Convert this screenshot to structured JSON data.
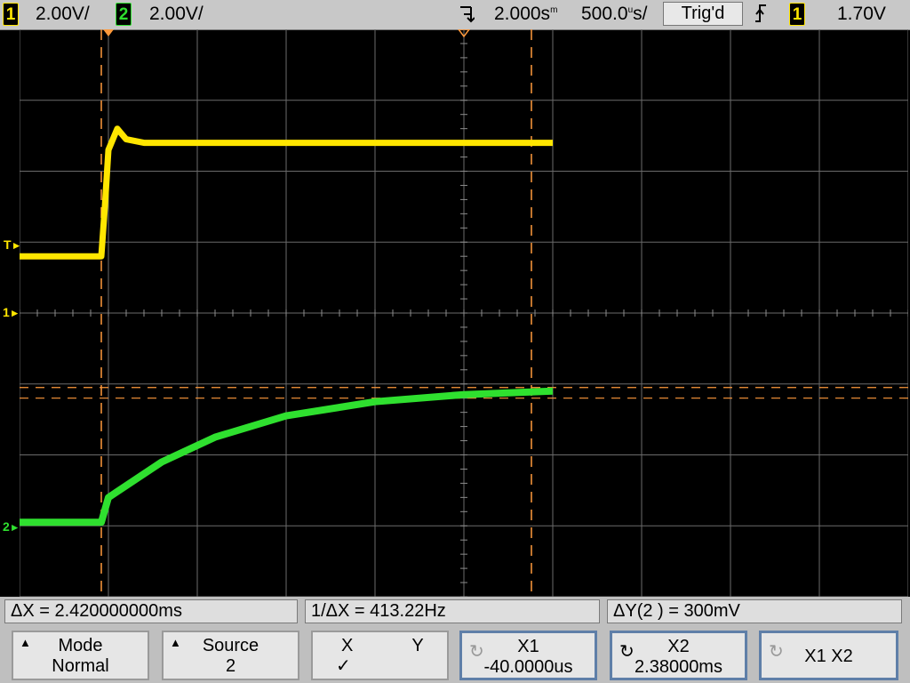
{
  "topbar": {
    "ch1_number": "1",
    "ch1_scale": "2.00V/",
    "ch2_number": "2",
    "ch2_scale": "2.00V/",
    "delay": "2.000s",
    "delay_unit_prefix": "m",
    "timebase": "500.0",
    "timebase_unit_prefix": "u",
    "timebase_suffix": "s/",
    "trigger_state": "Trig'd",
    "trigger_slope_icon": "rising-edge-icon",
    "trigger_source": "1",
    "trigger_level": "1.70V"
  },
  "markers": {
    "trigger_marker": "T",
    "ch1_ground": "1",
    "ch2_ground": "2"
  },
  "readouts": {
    "delta_x": "ΔX = 2.420000000ms",
    "inv_delta_x": "1/ΔX = 413.22Hz",
    "delta_y": "ΔY(2 ) = 300mV"
  },
  "softkeys": {
    "mode_label": "Mode",
    "mode_value": "Normal",
    "source_label": "Source",
    "source_value": "2",
    "xy_x": "X",
    "xy_y": "Y",
    "xy_check": "✓",
    "x1_label": "X1",
    "x1_value": "-40.0000us",
    "x2_label": "X2",
    "x2_value": "2.38000ms",
    "x1x2_label": "X1 X2"
  },
  "colors": {
    "ch1": "#ffe600",
    "ch2": "#2fe02f",
    "cursor": "#ff9a3c",
    "grid": "#6b6b6b"
  },
  "chart_data": {
    "type": "line",
    "series": [
      {
        "name": "1",
        "color": "#ffe600",
        "x_ms": [
          -2.5,
          -0.04,
          -0.02,
          0.0,
          0.05,
          0.1,
          0.2,
          2.5
        ],
        "y_div": [
          0.8,
          0.8,
          1.5,
          2.3,
          2.6,
          2.45,
          2.4,
          2.4
        ]
      },
      {
        "name": "2",
        "color": "#2fe02f",
        "x_ms": [
          -2.5,
          -0.04,
          0.0,
          0.3,
          0.6,
          1.0,
          1.5,
          2.0,
          2.5
        ],
        "y_div": [
          -2.95,
          -2.95,
          -2.6,
          -2.1,
          -1.75,
          -1.45,
          -1.25,
          -1.15,
          -1.1
        ]
      }
    ],
    "cursors": {
      "x1_ms": -0.04,
      "x2_ms": 2.38,
      "y1_div": -1.05,
      "y2_div": -1.2
    }
  }
}
